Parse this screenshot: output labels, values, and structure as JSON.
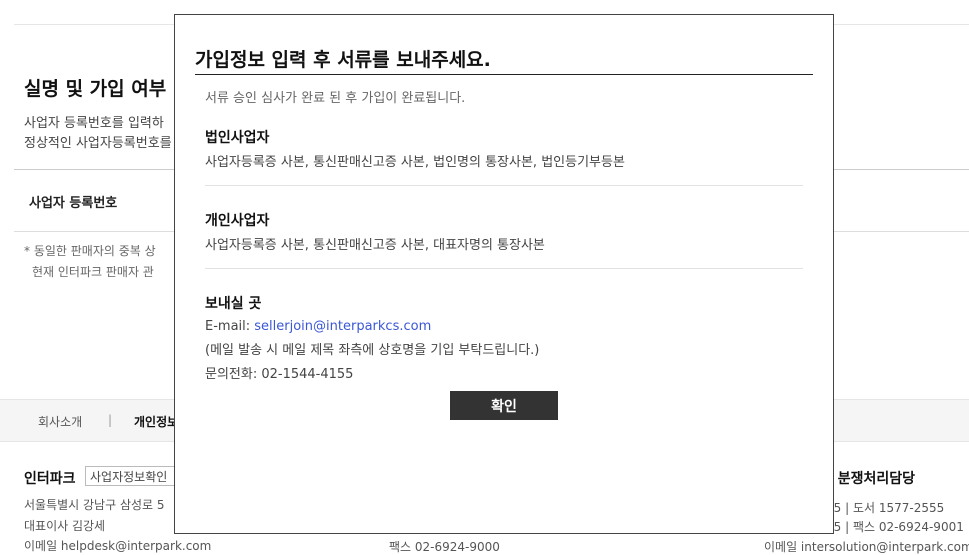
{
  "background": {
    "title": "실명 및 가입 여부",
    "desc_line1": "사업자 등록번호를 입력하",
    "desc_line2": "정상적인 사업자등록번호를",
    "form_label": "사업자 등록번호",
    "note_line1": "* 동일한 판매자의 중복 상",
    "note_line2": "현재 인터파크 판매자 관"
  },
  "footer": {
    "nav_about": "회사소개",
    "nav_sep": "|",
    "nav_privacy": "개인정보",
    "brand": "인터파크",
    "verify_label": "사업자정보확인",
    "address": "서울특별시 강남구 삼성로 5",
    "ceo": "대표이사 김강세",
    "email": "이메일 helpdesk@interpark.com",
    "fax_mid": "팩스 02-6924-9000",
    "right_title": "래 분쟁처리담당",
    "right_line1": "55 | 도서 1577-2555",
    "right_line2": "55 | 팩스 02-6924-9001",
    "right_email": "이메일 intersolution@interpark.com"
  },
  "modal": {
    "title": "가입정보 입력 후 서류를 보내주세요.",
    "subtitle": "서류 승인 심사가 완료 된 후 가입이 완료됩니다.",
    "corporate": {
      "heading": "법인사업자",
      "docs": "사업자등록증 사본, 통신판매신고증 사본, 법인명의 통장사본, 법인등기부등본"
    },
    "individual": {
      "heading": "개인사업자",
      "docs": "사업자등록증 사본, 통신판매신고증 사본, 대표자명의 통장사본"
    },
    "send_to": {
      "heading": "보내실 곳",
      "email_label": "E-mail: ",
      "email": "sellerjoin@interparkcs.com",
      "notice": "(메일 발송 시 메일 제목 좌측에 상호명을 기입 부탁드립니다.)",
      "phone": "문의전화: 02-1544-4155"
    },
    "confirm_label": "확인"
  }
}
